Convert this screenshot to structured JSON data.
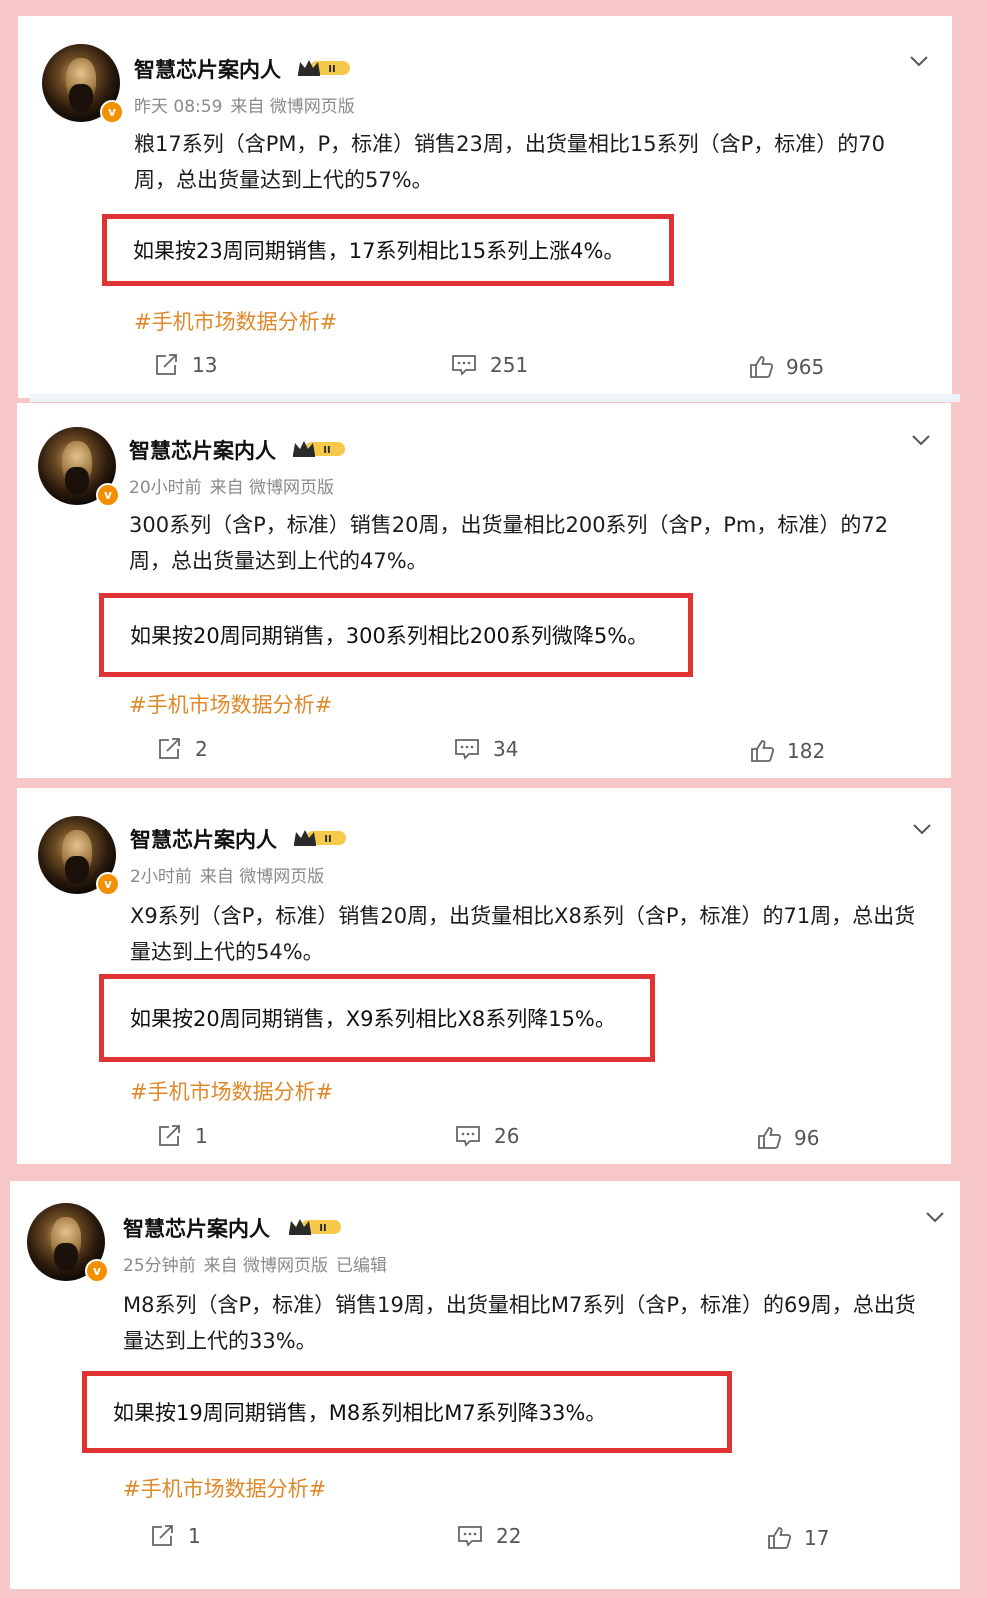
{
  "posts": [
    {
      "username": "智慧芯片案内人",
      "time": "昨天 08:59",
      "source": "来自 微博网页版",
      "edited": "",
      "body": "粮17系列（含PM，P，标准）销售23周，出货量相比15系列（含P，标准）的70周，总出货量达到上代的57%。",
      "highlight": "如果按23周同期销售，17系列相比15系列上涨4%。",
      "hashtag": "#手机市场数据分析#",
      "reposts": "13",
      "comments": "251",
      "likes": "965"
    },
    {
      "username": "智慧芯片案内人",
      "time": "20小时前",
      "source": "来自 微博网页版",
      "edited": "",
      "body": "300系列（含P，标准）销售20周，出货量相比200系列（含P，Pm，标准）的72周，总出货量达到上代的47%。",
      "highlight": "如果按20周同期销售，300系列相比200系列微降5%。",
      "hashtag": "#手机市场数据分析#",
      "reposts": "2",
      "comments": "34",
      "likes": "182"
    },
    {
      "username": "智慧芯片案内人",
      "time": "2小时前",
      "source": "来自 微博网页版",
      "edited": "",
      "body": "X9系列（含P，标准）销售20周，出货量相比X8系列（含P，标准）的71周，总出货量达到上代的54%。",
      "highlight": "如果按20周同期销售，X9系列相比X8系列降15%。",
      "hashtag": "#手机市场数据分析#",
      "reposts": "1",
      "comments": "26",
      "likes": "96"
    },
    {
      "username": "智慧芯片案内人",
      "time": "25分钟前",
      "source": "来自 微博网页版",
      "edited": "已编辑",
      "body": "M8系列（含P，标准）销售19周，出货量相比M7系列（含P，标准）的69周，总出货量达到上代的33%。",
      "highlight": "如果按19周同期销售，M8系列相比M7系列降33%。",
      "hashtag": "#手机市场数据分析#",
      "reposts": "1",
      "comments": "22",
      "likes": "17"
    }
  ],
  "colors": {
    "background": "#f7c6c6",
    "highlight_border": "#e03434",
    "hashtag": "#e0882a",
    "verified_badge": "#f39000",
    "meta_text": "#8a8a8a"
  },
  "icons": {
    "verified": "v-badge-icon",
    "level": "crown-level-icon",
    "menu": "chevron-down-icon",
    "repost": "repost-icon",
    "comment": "comment-icon",
    "like": "thumbs-up-icon"
  },
  "level_badge_text": "II",
  "verified_badge_text": "v"
}
